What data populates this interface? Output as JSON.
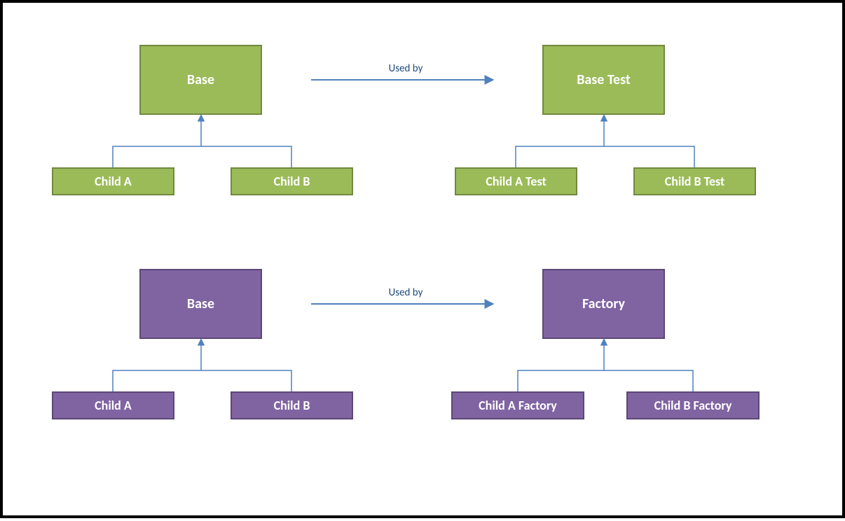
{
  "top": {
    "left": {
      "base": "Base",
      "childA": "Child A",
      "childB": "Child B"
    },
    "arrowLabel": "Used by",
    "right": {
      "base": "Base Test",
      "childA": "Child A Test",
      "childB": "Child B Test"
    }
  },
  "bottom": {
    "left": {
      "base": "Base",
      "childA": "Child A",
      "childB": "Child B"
    },
    "arrowLabel": "Used by",
    "right": {
      "base": "Factory",
      "childA": "Child A Factory",
      "childB": "Child B Factory"
    }
  },
  "colors": {
    "greenFill": "#9bbb59",
    "greenBorder": "#71893f",
    "purpleFill": "#8064a2",
    "purpleBorder": "#5c4776",
    "arrow": "#4f81bd"
  }
}
